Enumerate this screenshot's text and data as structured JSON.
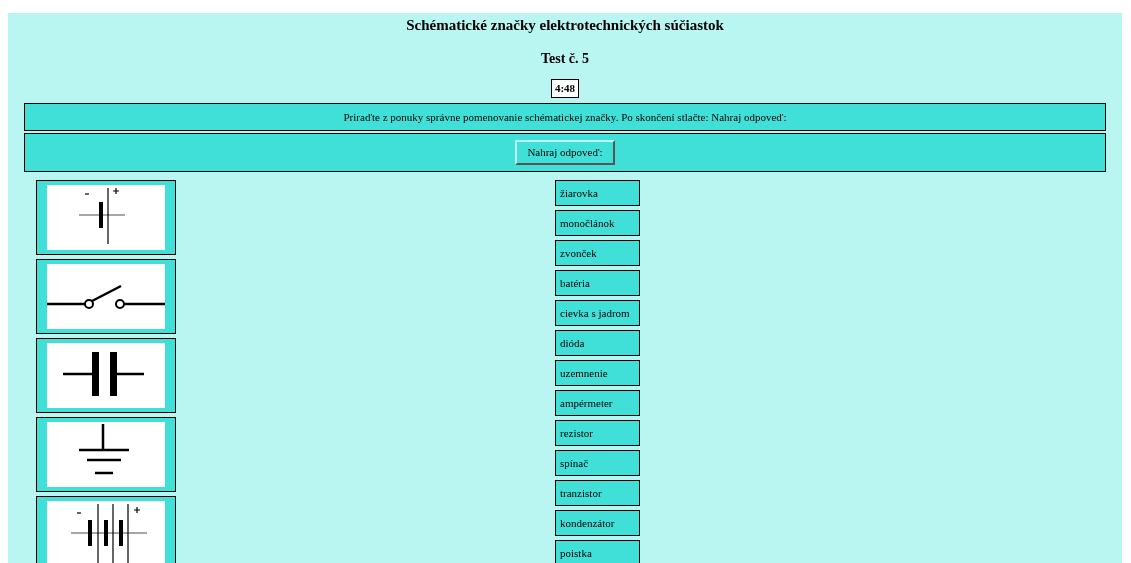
{
  "title": "Schématické značky elektrotechnických súčiastok",
  "subtitle": "Test č. 5",
  "timer": "4:48",
  "instruction": "Priraďte z ponuky správne pomenovanie schématickej značky. Po skončení stlačte: Nahraj odpoveď:",
  "submit_button": "Nahraj odpoveď:",
  "symbols": [
    {
      "kind": "cell"
    },
    {
      "kind": "switch"
    },
    {
      "kind": "capacitor"
    },
    {
      "kind": "ground"
    },
    {
      "kind": "battery"
    }
  ],
  "names": [
    "žiarovka",
    "monočlánok",
    "zvonček",
    "batéria",
    "cievka s jadrom",
    "dióda",
    "uzemnenie",
    "ampérmeter",
    "rezistor",
    "spínač",
    "tranzistor",
    "kondenzátor",
    "poistka"
  ]
}
